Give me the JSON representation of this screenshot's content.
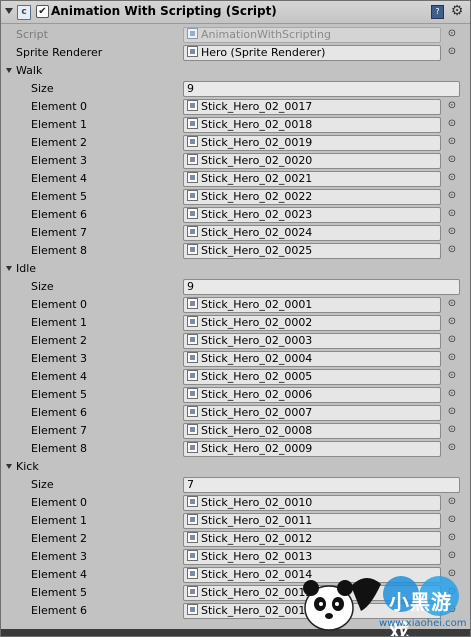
{
  "component": {
    "title": "Animation With Scripting (Script)",
    "enabled": true,
    "icons": {
      "component": "script-icon",
      "help": "book-icon",
      "settings": "gear-icon"
    }
  },
  "script": {
    "label": "Script",
    "value": "AnimationWithScripting"
  },
  "sprite_renderer": {
    "label": "Sprite Renderer",
    "value": "Hero (Sprite Renderer)"
  },
  "size_label": "Size",
  "walk": {
    "label": "Walk",
    "size": "9",
    "elements": [
      {
        "label": "Element 0",
        "value": "Stick_Hero_02_0017"
      },
      {
        "label": "Element 1",
        "value": "Stick_Hero_02_0018"
      },
      {
        "label": "Element 2",
        "value": "Stick_Hero_02_0019"
      },
      {
        "label": "Element 3",
        "value": "Stick_Hero_02_0020"
      },
      {
        "label": "Element 4",
        "value": "Stick_Hero_02_0021"
      },
      {
        "label": "Element 5",
        "value": "Stick_Hero_02_0022"
      },
      {
        "label": "Element 6",
        "value": "Stick_Hero_02_0023"
      },
      {
        "label": "Element 7",
        "value": "Stick_Hero_02_0024"
      },
      {
        "label": "Element 8",
        "value": "Stick_Hero_02_0025"
      }
    ]
  },
  "idle": {
    "label": "Idle",
    "size": "9",
    "elements": [
      {
        "label": "Element 0",
        "value": "Stick_Hero_02_0001"
      },
      {
        "label": "Element 1",
        "value": "Stick_Hero_02_0002"
      },
      {
        "label": "Element 2",
        "value": "Stick_Hero_02_0003"
      },
      {
        "label": "Element 3",
        "value": "Stick_Hero_02_0004"
      },
      {
        "label": "Element 4",
        "value": "Stick_Hero_02_0005"
      },
      {
        "label": "Element 5",
        "value": "Stick_Hero_02_0006"
      },
      {
        "label": "Element 6",
        "value": "Stick_Hero_02_0007"
      },
      {
        "label": "Element 7",
        "value": "Stick_Hero_02_0008"
      },
      {
        "label": "Element 8",
        "value": "Stick_Hero_02_0009"
      }
    ]
  },
  "kick": {
    "label": "Kick",
    "size": "7",
    "elements": [
      {
        "label": "Element 0",
        "value": "Stick_Hero_02_0010"
      },
      {
        "label": "Element 1",
        "value": "Stick_Hero_02_0011"
      },
      {
        "label": "Element 2",
        "value": "Stick_Hero_02_0012"
      },
      {
        "label": "Element 3",
        "value": "Stick_Hero_02_0013"
      },
      {
        "label": "Element 4",
        "value": "Stick_Hero_02_0014"
      },
      {
        "label": "Element 5",
        "value": "Stick_Hero_02_0015"
      },
      {
        "label": "Element 6",
        "value": "Stick_Hero_02_0016"
      }
    ]
  },
  "watermark": {
    "brand": "小黑游戏",
    "url": "www.xiaohei.com"
  }
}
